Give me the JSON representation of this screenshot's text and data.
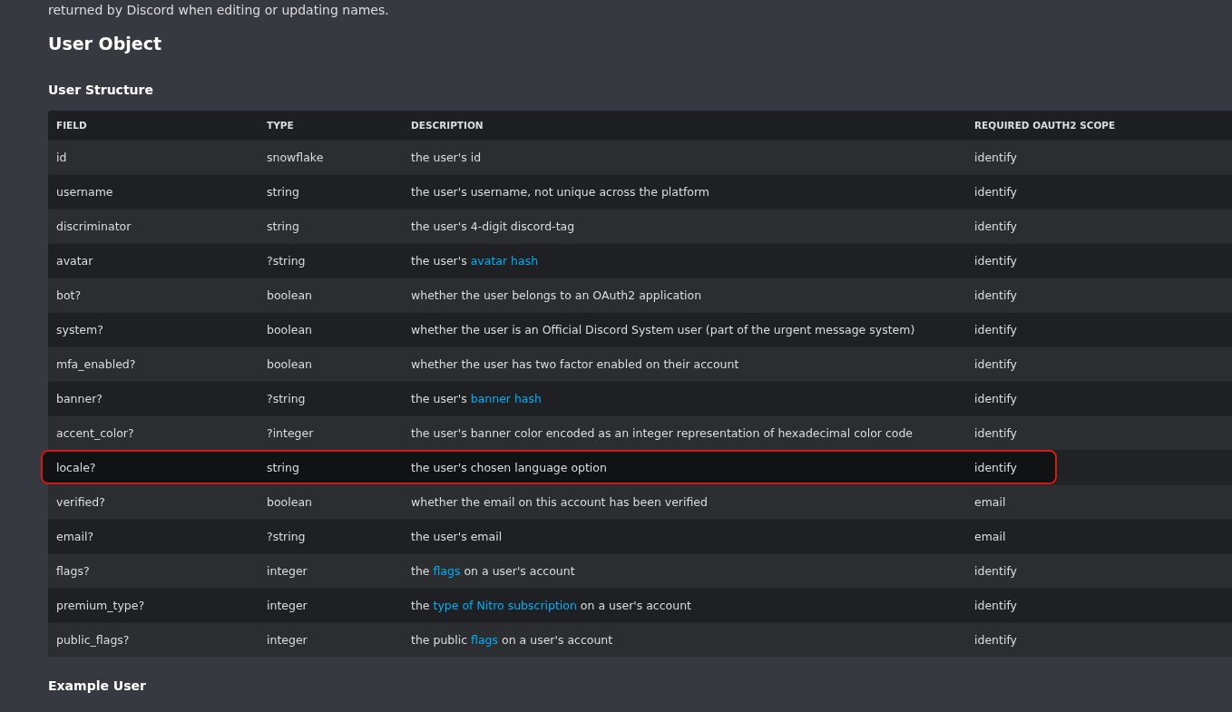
{
  "intro_text": "returned by Discord when editing or updating names.",
  "heading": "User Object",
  "subheading": "User Structure",
  "table": {
    "columns": [
      "FIELD",
      "TYPE",
      "DESCRIPTION",
      "REQUIRED OAUTH2 SCOPE"
    ],
    "rows": [
      {
        "field": "id",
        "type": "snowflake",
        "description": [
          {
            "text": "the user's id"
          }
        ],
        "scope": "identify",
        "highlighted": false
      },
      {
        "field": "username",
        "type": "string",
        "description": [
          {
            "text": "the user's username, not unique across the platform"
          }
        ],
        "scope": "identify",
        "highlighted": false
      },
      {
        "field": "discriminator",
        "type": "string",
        "description": [
          {
            "text": "the user's 4-digit discord-tag"
          }
        ],
        "scope": "identify",
        "highlighted": false
      },
      {
        "field": "avatar",
        "type": "?string",
        "description": [
          {
            "text": "the user's "
          },
          {
            "text": "avatar hash",
            "link": true
          }
        ],
        "scope": "identify",
        "highlighted": false
      },
      {
        "field": "bot?",
        "type": "boolean",
        "description": [
          {
            "text": "whether the user belongs to an OAuth2 application"
          }
        ],
        "scope": "identify",
        "highlighted": false
      },
      {
        "field": "system?",
        "type": "boolean",
        "description": [
          {
            "text": "whether the user is an Official Discord System user (part of the urgent message system)"
          }
        ],
        "scope": "identify",
        "highlighted": false
      },
      {
        "field": "mfa_enabled?",
        "type": "boolean",
        "description": [
          {
            "text": "whether the user has two factor enabled on their account"
          }
        ],
        "scope": "identify",
        "highlighted": false
      },
      {
        "field": "banner?",
        "type": "?string",
        "description": [
          {
            "text": "the user's "
          },
          {
            "text": "banner hash",
            "link": true
          }
        ],
        "scope": "identify",
        "highlighted": false
      },
      {
        "field": "accent_color?",
        "type": "?integer",
        "description": [
          {
            "text": "the user's banner color encoded as an integer representation of hexadecimal color code"
          }
        ],
        "scope": "identify",
        "highlighted": false
      },
      {
        "field": "locale?",
        "type": "string",
        "description": [
          {
            "text": "the user's chosen language option"
          }
        ],
        "scope": "identify",
        "highlighted": true
      },
      {
        "field": "verified?",
        "type": "boolean",
        "description": [
          {
            "text": "whether the email on this account has been verified"
          }
        ],
        "scope": "email",
        "highlighted": false
      },
      {
        "field": "email?",
        "type": "?string",
        "description": [
          {
            "text": "the user's email"
          }
        ],
        "scope": "email",
        "highlighted": false
      },
      {
        "field": "flags?",
        "type": "integer",
        "description": [
          {
            "text": "the "
          },
          {
            "text": "flags",
            "link": true
          },
          {
            "text": " on a user's account"
          }
        ],
        "scope": "identify",
        "highlighted": false
      },
      {
        "field": "premium_type?",
        "type": "integer",
        "description": [
          {
            "text": "the "
          },
          {
            "text": "type of Nitro subscription",
            "link": true
          },
          {
            "text": " on a user's account"
          }
        ],
        "scope": "identify",
        "highlighted": false
      },
      {
        "field": "public_flags?",
        "type": "integer",
        "description": [
          {
            "text": "the public "
          },
          {
            "text": "flags",
            "link": true
          },
          {
            "text": " on a user's account"
          }
        ],
        "scope": "identify",
        "highlighted": false
      }
    ]
  },
  "next_heading": "Example User"
}
